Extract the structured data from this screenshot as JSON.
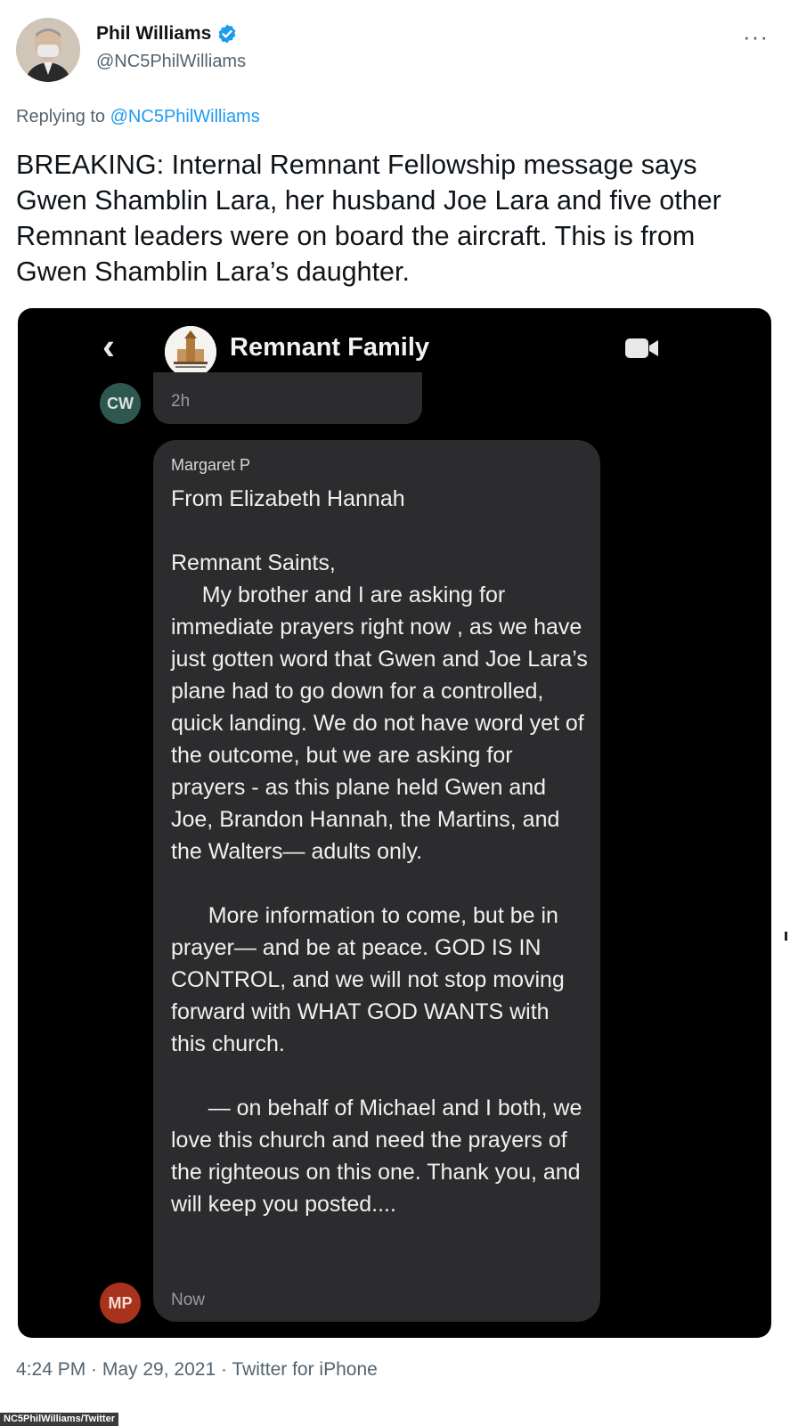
{
  "author": {
    "name": "Phil Williams",
    "handle": "@NC5PhilWilliams",
    "verified_icon": "verified-badge-icon",
    "verified_color": "#1d9bf0"
  },
  "more_label": "···",
  "reply": {
    "prefix": "Replying to ",
    "target": "@NC5PhilWilliams"
  },
  "tweet_text": "BREAKING: Internal Remnant Fellowship message says Gwen Shamblin Lara, her husband Joe Lara and five other Remnant leaders were on board the aircraft. This is from Gwen Shamblin Lara’s daughter.",
  "chat": {
    "back_glyph": "‹",
    "group_name": "Remnant Family",
    "previous": {
      "avatar_initials": "CW",
      "time": "2h"
    },
    "message": {
      "sender": "Margaret P",
      "body": "From Elizabeth Hannah\n\nRemnant Saints,\n     My brother and I are asking for immediate prayers right now , as we have just gotten word that Gwen and Joe Lara’s plane had to go down for a controlled, quick landing. We do not have word yet of the outcome, but we are asking for prayers - as this plane held Gwen and Joe, Brandon Hannah, the Martins, and the Walters— adults only.\n\n      More information to come, but be in prayer— and be at peace. GOD IS IN CONTROL, and we will not stop moving forward with WHAT GOD WANTS with this church.\n\n      — on behalf of Michael and I both, we love this church and need the prayers of the righteous on this one. Thank you, and will keep you posted....",
      "time": "Now",
      "avatar_initials": "MP"
    }
  },
  "footer": "4:24 PM · May 29, 2021 · Twitter for iPhone",
  "credit": "NC5PhilWilliams/Twitter"
}
